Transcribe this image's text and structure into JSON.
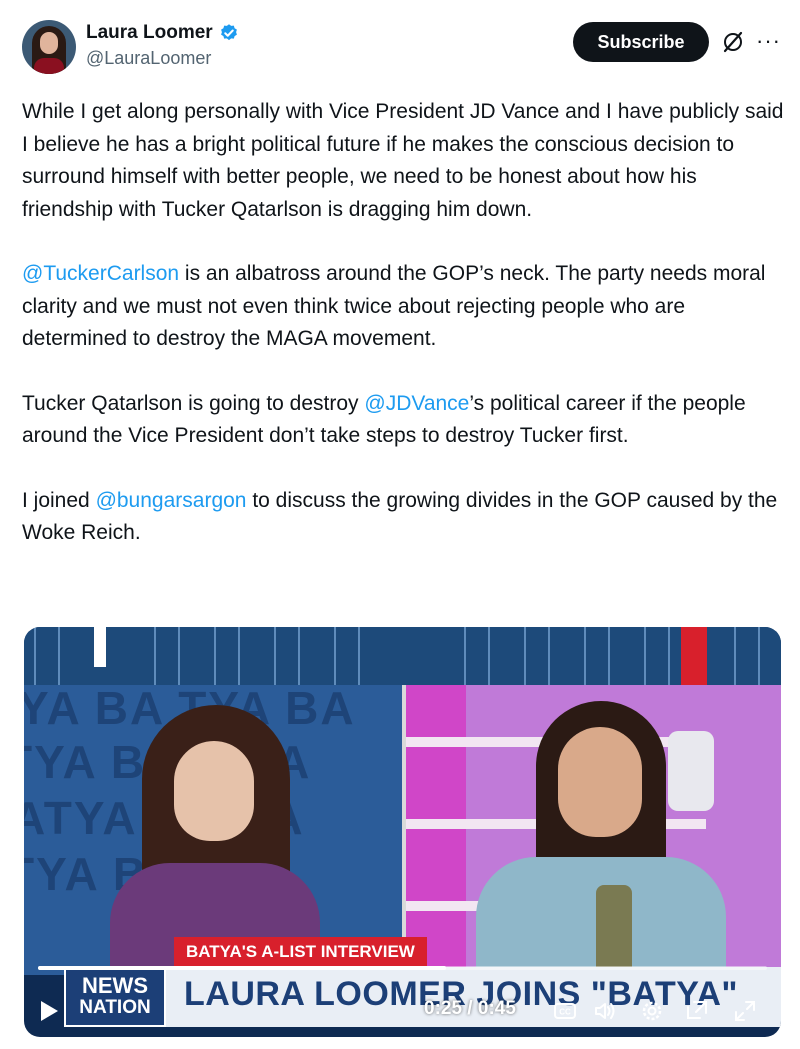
{
  "author": {
    "display_name": "Laura Loomer",
    "handle": "@LauraLoomer",
    "verified_icon": "verified-badge-icon",
    "verified_color": "#1d9bf0"
  },
  "header": {
    "subscribe_label": "Subscribe",
    "grok_icon": "grok-icon",
    "more_icon": "more-icon",
    "more_glyph": "···"
  },
  "tweet": {
    "p1": "While I get along personally with Vice President JD Vance and I have publicly said I believe he has a bright political future if he makes the conscious decision to surround himself with better people, we need to be honest about how his friendship with Tucker Qatarlson is dragging him down.",
    "p2_mention": "@TuckerCarlson",
    "p2_rest": " is an albatross around the GOP’s neck. The party needs moral clarity and we must not even think twice about rejecting people who are determined to destroy the MAGA movement.",
    "p3_start": "Tucker Qatarlson is going to destroy ",
    "p3_mention": "@JDVance",
    "p3_rest": "’s political career if the people around the Vice President don’t take steps to destroy Tucker first.",
    "p4_start": "I joined ",
    "p4_mention": "@bungarsargon",
    "p4_rest": " to discuss the growing divides in the GOP caused by the Woke Reich."
  },
  "video": {
    "background_text": [
      "YA  BA TYA  BA",
      "TYA  BA  A BA",
      "ATYA  BA  BA",
      "TYA  BA  BA"
    ],
    "lower_third_label": "BATYA'S A-LIST INTERVIEW",
    "logo_line1": "NEWS",
    "logo_line2": "NATION",
    "headline": "LAURA LOOMER JOINS \"BATYA\"",
    "current_time": "0:25",
    "separator": " / ",
    "duration": "0:45",
    "progress": 0.56,
    "icons": [
      "play-icon",
      "captions-icon",
      "volume-icon",
      "settings-icon",
      "pip-icon",
      "fullscreen-icon"
    ]
  },
  "colors": {
    "mention": "#1d9bf0",
    "text": "#0f1419",
    "muted": "#536471",
    "accent_red": "#d8202c",
    "newsnation_blue": "#1c3f77"
  }
}
